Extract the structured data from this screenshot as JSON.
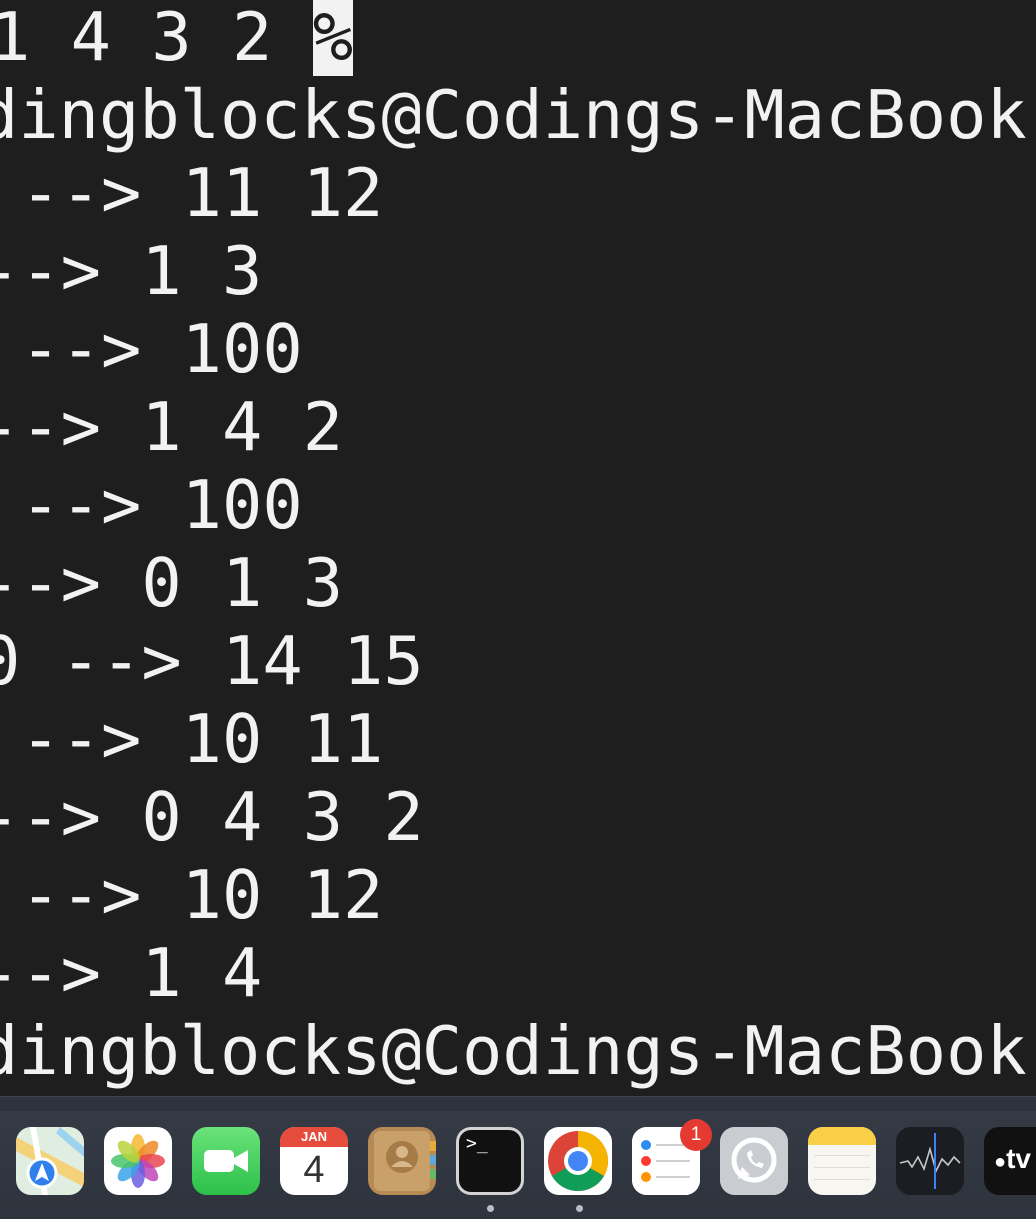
{
  "terminal": {
    "lines": [
      {
        "text": "1 4 3 2 ",
        "cursor": "%"
      },
      {
        "text": "dingblocks@Codings-MacBook-"
      },
      {
        "text": " --> 11 12"
      },
      {
        "text": "--> 1 3"
      },
      {
        "text": " --> 100"
      },
      {
        "text": "--> 1 4 2"
      },
      {
        "text": " --> 100"
      },
      {
        "text": "--> 0 1 3"
      },
      {
        "text": "0 --> 14 15"
      },
      {
        "text": " --> 10 11"
      },
      {
        "text": "--> 0 4 3 2"
      },
      {
        "text": " --> 10 12"
      },
      {
        "text": "--> 1 4"
      },
      {
        "text": "dingblocks@Codings-MacBook-"
      }
    ]
  },
  "dock": {
    "apps": [
      {
        "name": "maps-icon"
      },
      {
        "name": "photos-icon"
      },
      {
        "name": "facetime-icon"
      },
      {
        "name": "calendar-icon",
        "month": "JAN",
        "day": "4"
      },
      {
        "name": "contacts-icon"
      },
      {
        "name": "terminal-icon",
        "running": true
      },
      {
        "name": "chrome-icon",
        "running": true
      },
      {
        "name": "reminders-icon",
        "badge": "1"
      },
      {
        "name": "whatsapp-icon"
      },
      {
        "name": "notes-icon"
      },
      {
        "name": "voice-memos-icon"
      },
      {
        "name": "apple-tv-icon",
        "label": "tv"
      }
    ]
  }
}
